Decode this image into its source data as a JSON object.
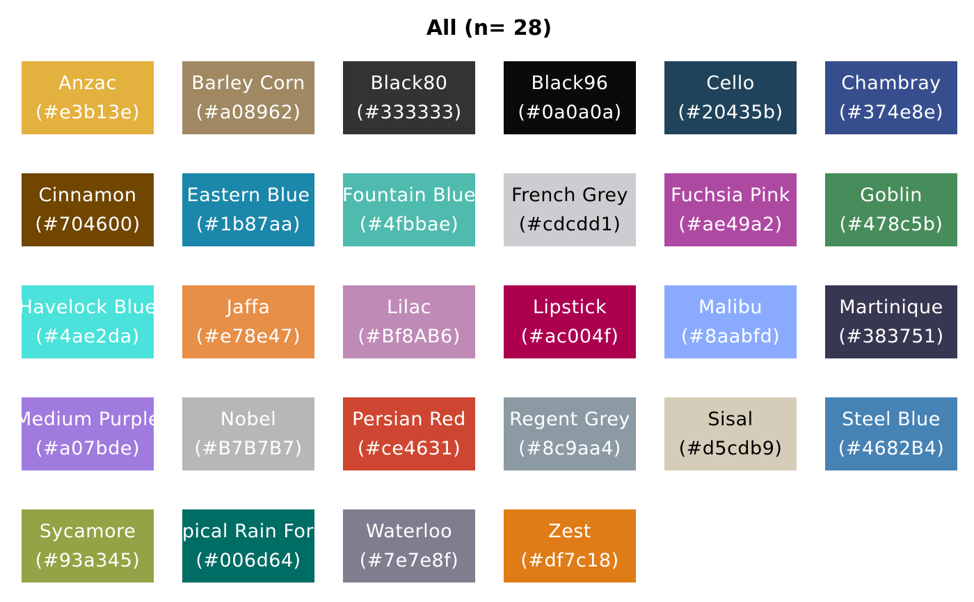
{
  "title": "All (n= 28)",
  "swatches": [
    {
      "name": "Anzac",
      "hex": "(#e3b13e)",
      "color": "#e3b13e",
      "text_color": "#ffffff"
    },
    {
      "name": "Barley Corn",
      "hex": "(#a08962)",
      "color": "#a08962",
      "text_color": "#ffffff"
    },
    {
      "name": "Black80",
      "hex": "(#333333)",
      "color": "#333333",
      "text_color": "#ffffff"
    },
    {
      "name": "Black96",
      "hex": "(#0a0a0a)",
      "color": "#0a0a0a",
      "text_color": "#ffffff"
    },
    {
      "name": "Cello",
      "hex": "(#20435b)",
      "color": "#20435b",
      "text_color": "#ffffff"
    },
    {
      "name": "Chambray",
      "hex": "(#374e8e)",
      "color": "#374e8e",
      "text_color": "#ffffff"
    },
    {
      "name": "Cinnamon",
      "hex": "(#704600)",
      "color": "#704600",
      "text_color": "#ffffff"
    },
    {
      "name": "Eastern Blue",
      "hex": "(#1b87aa)",
      "color": "#1b87aa",
      "text_color": "#ffffff"
    },
    {
      "name": "Fountain Blue",
      "hex": "(#4fbbae)",
      "color": "#4fbbae",
      "text_color": "#ffffff"
    },
    {
      "name": "French Grey",
      "hex": "(#cdcdd1)",
      "color": "#cdcdd1",
      "text_color": "#000000"
    },
    {
      "name": "Fuchsia Pink",
      "hex": "(#ae49a2)",
      "color": "#ae49a2",
      "text_color": "#ffffff"
    },
    {
      "name": "Goblin",
      "hex": "(#478c5b)",
      "color": "#478c5b",
      "text_color": "#ffffff"
    },
    {
      "name": "Havelock Blue",
      "hex": "(#4ae2da)",
      "color": "#4ae2da",
      "text_color": "#ffffff"
    },
    {
      "name": "Jaffa",
      "hex": "(#e78e47)",
      "color": "#e78e47",
      "text_color": "#ffffff"
    },
    {
      "name": "Lilac",
      "hex": "(#Bf8AB6)",
      "color": "#bf8ab6",
      "text_color": "#ffffff"
    },
    {
      "name": "Lipstick",
      "hex": "(#ac004f)",
      "color": "#ac004f",
      "text_color": "#ffffff"
    },
    {
      "name": "Malibu",
      "hex": "(#8aabfd)",
      "color": "#8aabfd",
      "text_color": "#ffffff"
    },
    {
      "name": "Martinique",
      "hex": "(#383751)",
      "color": "#383751",
      "text_color": "#ffffff"
    },
    {
      "name": "Medium Purple",
      "hex": "(#a07bde)",
      "color": "#a07bde",
      "text_color": "#ffffff"
    },
    {
      "name": "Nobel",
      "hex": "(#B7B7B7)",
      "color": "#b7b7b7",
      "text_color": "#ffffff"
    },
    {
      "name": "Persian Red",
      "hex": "(#ce4631)",
      "color": "#ce4631",
      "text_color": "#ffffff"
    },
    {
      "name": "Regent Grey",
      "hex": "(#8c9aa4)",
      "color": "#8c9aa4",
      "text_color": "#ffffff"
    },
    {
      "name": "Sisal",
      "hex": "(#d5cdb9)",
      "color": "#d5cdb9",
      "text_color": "#000000"
    },
    {
      "name": "Steel Blue",
      "hex": "(#4682B4)",
      "color": "#4682b4",
      "text_color": "#ffffff"
    },
    {
      "name": "Sycamore",
      "hex": "(#93a345)",
      "color": "#93a345",
      "text_color": "#ffffff"
    },
    {
      "name": "Tropical Rain Forest",
      "hex": "(#006d64)",
      "color": "#006d64",
      "text_color": "#ffffff"
    },
    {
      "name": "Waterloo",
      "hex": "(#7e7e8f)",
      "color": "#7e7e8f",
      "text_color": "#ffffff"
    },
    {
      "name": "Zest",
      "hex": "(#df7c18)",
      "color": "#df7c18",
      "text_color": "#ffffff"
    }
  ]
}
